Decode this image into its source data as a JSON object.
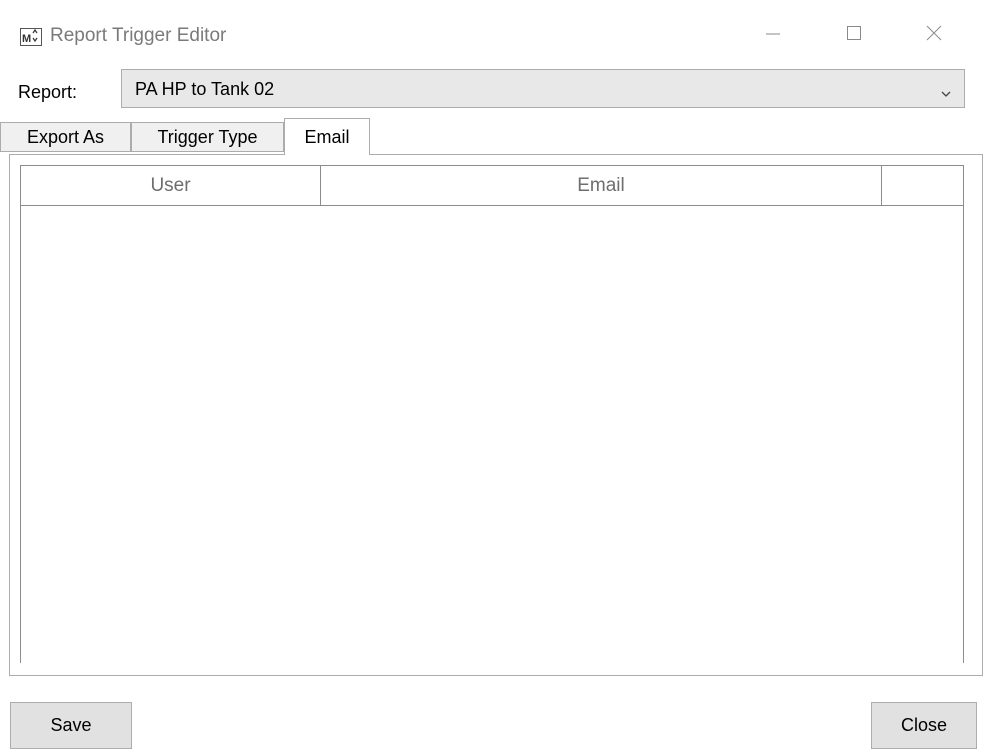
{
  "window": {
    "title": "Report Trigger Editor",
    "app_icon": "app-logo-icon",
    "controls": [
      "minimize-icon",
      "maximize-icon",
      "close-icon"
    ]
  },
  "report": {
    "label": "Report:",
    "selected": "PA HP to Tank 02"
  },
  "tabs": [
    {
      "label": "Export As",
      "active": false
    },
    {
      "label": "Trigger Type",
      "active": false
    },
    {
      "label": "Email",
      "active": true
    }
  ],
  "grid": {
    "columns": [
      "User",
      "Email",
      ""
    ],
    "rows": []
  },
  "buttons": {
    "save": "Save",
    "close": "Close"
  }
}
